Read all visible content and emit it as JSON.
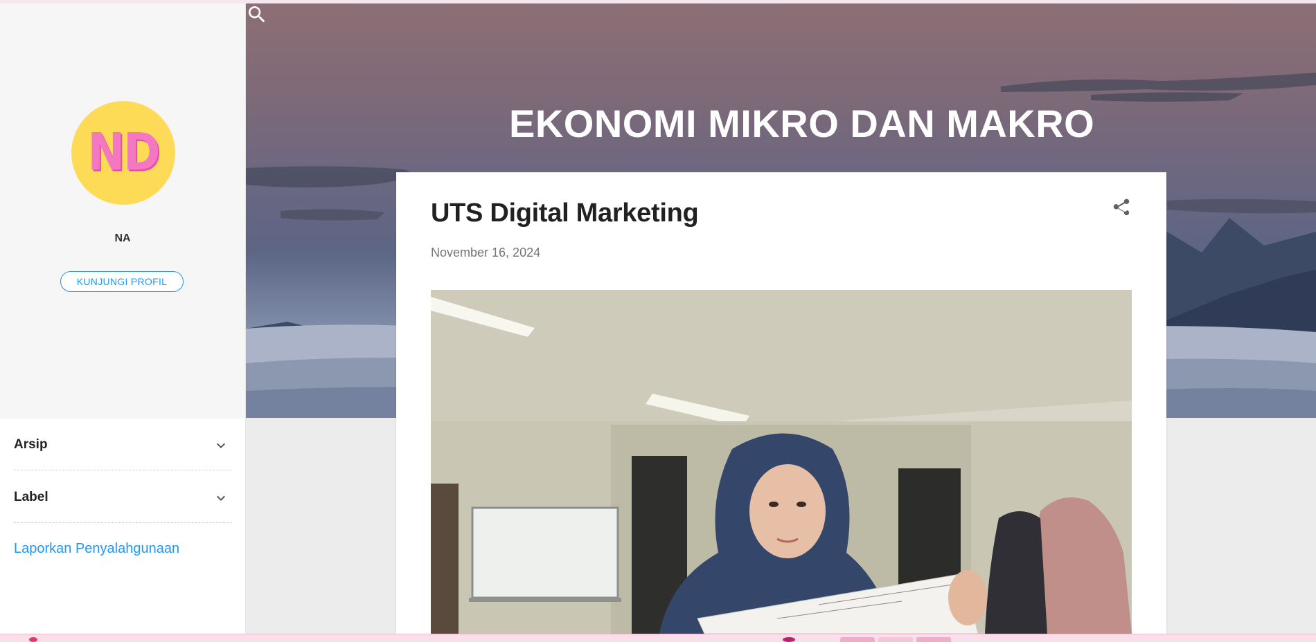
{
  "blog": {
    "title": "EKONOMI MIKRO DAN MAKRO"
  },
  "profile": {
    "avatar_text": "ND",
    "name": "NA",
    "visit_button": "KUNJUNGI PROFIL"
  },
  "sidebar": {
    "widgets": [
      {
        "label": "Arsip",
        "icon": "chevron-down-icon"
      },
      {
        "label": "Label",
        "icon": "chevron-down-icon"
      }
    ],
    "report_link": "Laporkan Penyalahgunaan"
  },
  "post": {
    "title": "UTS Digital Marketing",
    "date": "November 16, 2024",
    "image": "photo of a student in a hijab holding a sheet of paper in a classroom"
  },
  "icons": {
    "search": "search-icon",
    "share": "share-icon"
  },
  "colors": {
    "accent": "#2196f3",
    "avatar_bg": "#fddb57",
    "avatar_text": "#f477c2"
  }
}
